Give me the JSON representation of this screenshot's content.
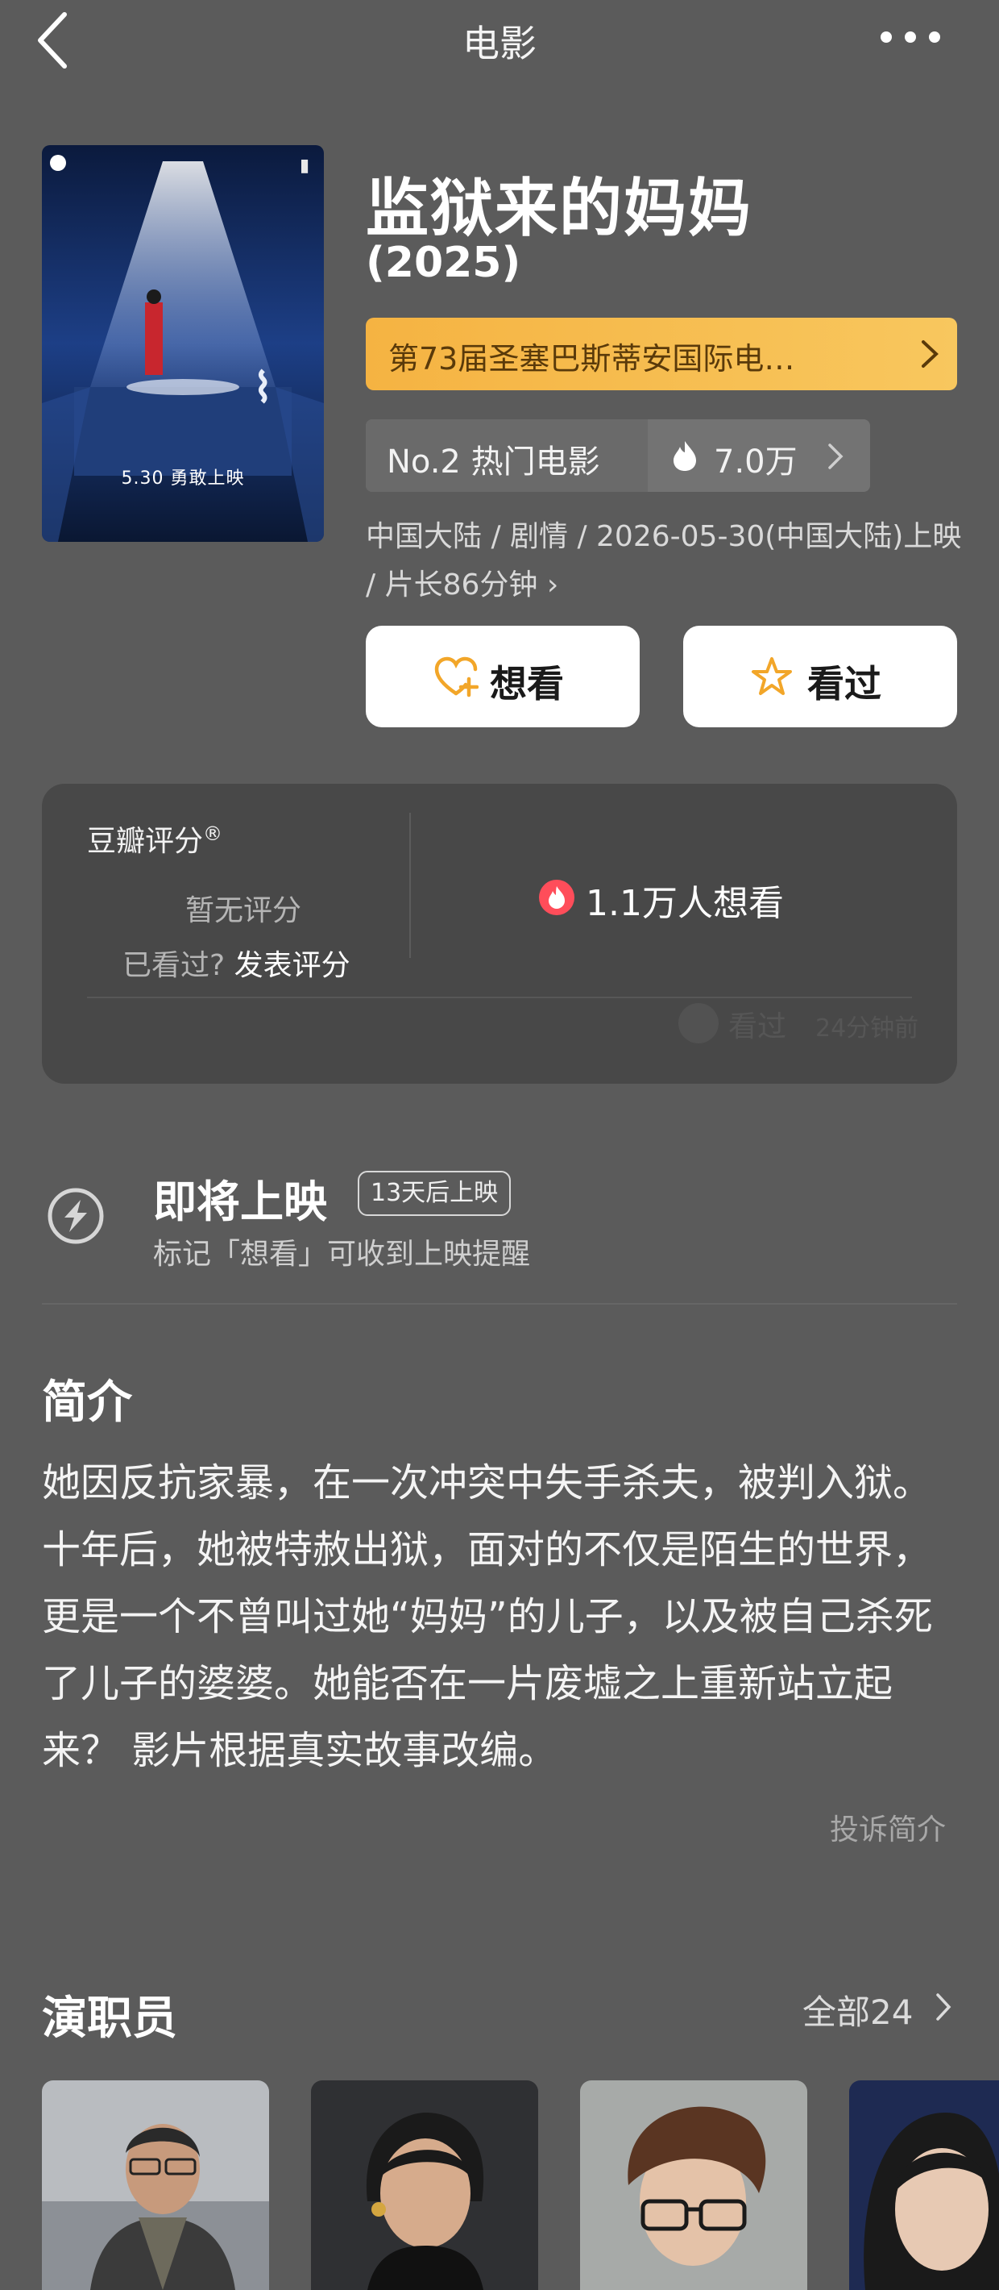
{
  "nav": {
    "title": "电影"
  },
  "poster": {
    "date_text": "5.30 勇敢上映"
  },
  "movie": {
    "title": "监狱来的妈妈",
    "year": "(2025)",
    "festival": "第73届圣塞巴斯蒂安国际电…",
    "rank": "No.2 热门电影",
    "hot_count": "7.0万",
    "info": "中国大陆 / 剧情 / 2026-05-30(中国大陆)上映 / 片长86分钟 ›"
  },
  "actions": {
    "want": "想看",
    "seen": "看过"
  },
  "rating": {
    "title": "豆瓣评分",
    "trademark": "®",
    "no_rating": "暂无评分",
    "seen_prompt": "已看过?",
    "rate_link": "发表评分",
    "want_count": "1.1万人想看",
    "recent_seen": "看过",
    "recent_time": "24分钟前"
  },
  "upcoming": {
    "title": "即将上映",
    "countdown": "13天后上映",
    "hint": "标记「想看」可收到上映提醒"
  },
  "synopsis": {
    "heading": "简介",
    "text": "她因反抗家暴，在一次冲突中失手杀夫，被判入狱。十年后，她被特赦出狱，面对的不仅是陌生的世界，更是一个不曾叫过她“妈妈”的儿子，以及被自己杀死了儿子的婆婆。她能否在一片废墟之上重新站立起来？ 影片根据真实故事改编。",
    "report": "投诉简介"
  },
  "cast": {
    "heading": "演职员",
    "all_label": "全部24"
  },
  "colors": {
    "background": "#5b5b5b",
    "festival_bar": "#f5b342",
    "card": "#484848",
    "fire": "#ff4d5a"
  },
  "icons": [
    "back-icon",
    "more-icon",
    "chevron-right-icon",
    "flame-icon",
    "heart-plus-icon",
    "star-icon",
    "reminder-icon"
  ]
}
